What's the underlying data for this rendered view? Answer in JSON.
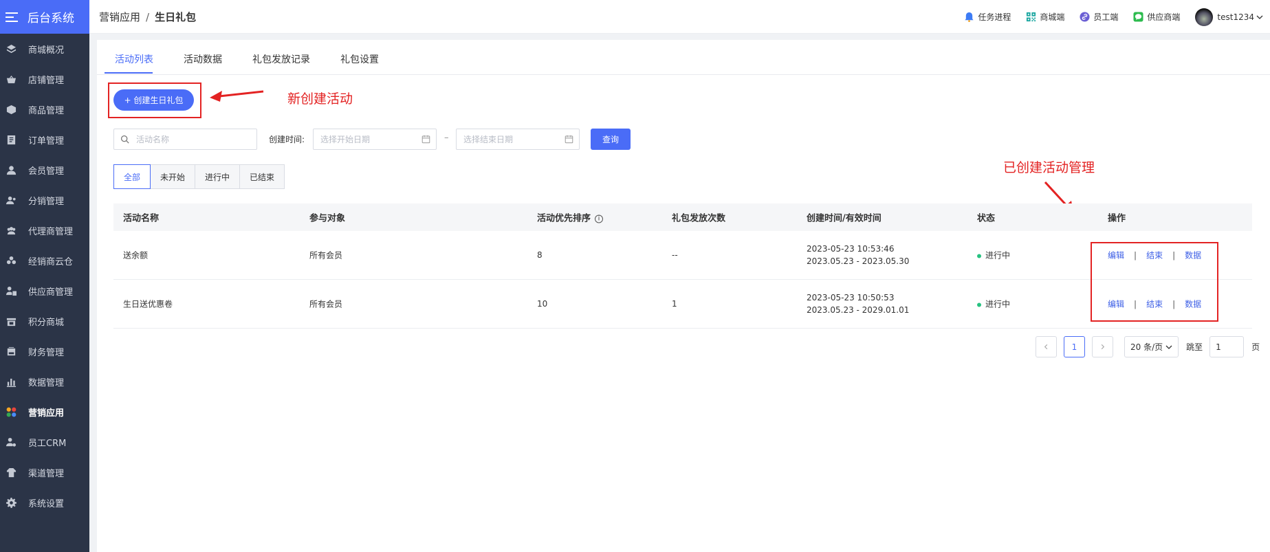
{
  "sidebar": {
    "brand": "后台系统",
    "items": [
      {
        "label": "商城概况",
        "icon": "layers-icon"
      },
      {
        "label": "店铺管理",
        "icon": "basket-icon"
      },
      {
        "label": "商品管理",
        "icon": "box-icon"
      },
      {
        "label": "订单管理",
        "icon": "order-list-icon"
      },
      {
        "label": "会员管理",
        "icon": "user-icon"
      },
      {
        "label": "分销管理",
        "icon": "distribution-icon"
      },
      {
        "label": "代理商管理",
        "icon": "agents-icon"
      },
      {
        "label": "经销商云仓",
        "icon": "cloud-warehouse-icon"
      },
      {
        "label": "供应商管理",
        "icon": "supplier-icon"
      },
      {
        "label": "积分商城",
        "icon": "points-store-icon"
      },
      {
        "label": "财务管理",
        "icon": "finance-icon"
      },
      {
        "label": "数据管理",
        "icon": "bar-chart-icon"
      },
      {
        "label": "营销应用",
        "icon": "apps-icon",
        "active": true
      },
      {
        "label": "员工CRM",
        "icon": "crm-icon"
      },
      {
        "label": "渠道管理",
        "icon": "channel-icon"
      },
      {
        "label": "系统设置",
        "icon": "gear-icon"
      }
    ]
  },
  "header": {
    "breadcrumb": [
      "营销应用",
      "生日礼包"
    ],
    "breadcrumb_sep": "/",
    "links": [
      {
        "label": "任务进程",
        "icon": "bell-icon"
      },
      {
        "label": "商城端",
        "icon": "qrcode-icon"
      },
      {
        "label": "员工端",
        "icon": "staff-link-icon"
      },
      {
        "label": "供应商端",
        "icon": "wechat-icon"
      }
    ],
    "username": "test1234"
  },
  "tabs": [
    "活动列表",
    "活动数据",
    "礼包发放记录",
    "礼包设置"
  ],
  "toolbar": {
    "create_label": "+ 创建生日礼包",
    "search_placeholder": "活动名称",
    "date_label": "创建时间:",
    "start_placeholder": "选择开始日期",
    "date_sep": "–",
    "end_placeholder": "选择结束日期",
    "query_label": "查询"
  },
  "filters": [
    "全部",
    "未开始",
    "进行中",
    "已结束"
  ],
  "annotations": {
    "create": "新创建活动",
    "manage": "已创建活动管理"
  },
  "table": {
    "columns": [
      "活动名称",
      "参与对象",
      "活动优先排序",
      "礼包发放次数",
      "创建时间/有效时间",
      "状态",
      "操作"
    ],
    "rows": [
      {
        "name": "送余额",
        "target": "所有会员",
        "priority": "8",
        "count": "--",
        "created": "2023-05-23 10:53:46",
        "valid": "2023.05.23 - 2023.05.30",
        "status": "进行中"
      },
      {
        "name": "生日送优惠卷",
        "target": "所有会员",
        "priority": "10",
        "count": "1",
        "created": "2023-05-23 10:50:53",
        "valid": "2023.05.23 - 2029.01.01",
        "status": "进行中"
      }
    ],
    "actions": [
      "编辑",
      "结束",
      "数据"
    ],
    "action_sep": "|"
  },
  "pagination": {
    "current": "1",
    "page_size": "20 条/页",
    "jump_label": "跳至",
    "jump_value": "1",
    "page_suffix": "页"
  },
  "colors": {
    "accent": "#4a6cf7",
    "sidebar_bg": "#2b3447",
    "annotation_red": "#e32222",
    "status_green": "#27c281"
  }
}
